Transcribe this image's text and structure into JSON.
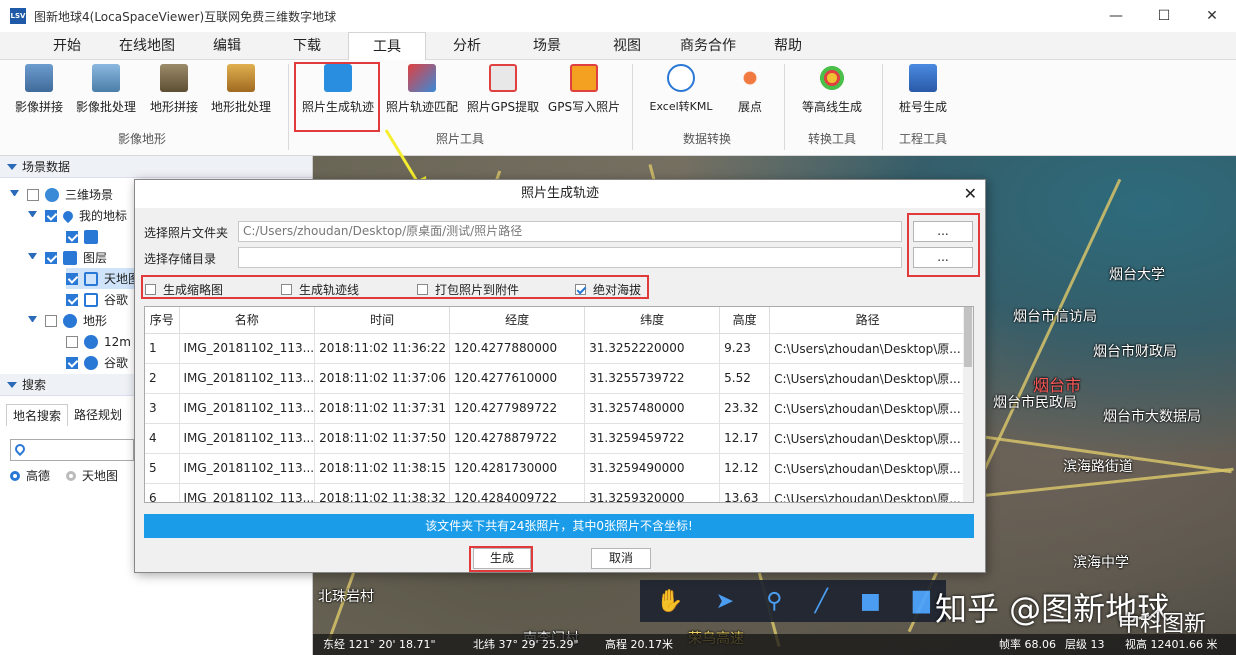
{
  "window": {
    "logo": "LSV",
    "title": "图新地球4(LocaSpaceViewer)互联网免费三维数字地球",
    "minimize": "—",
    "maximize": "☐",
    "close": "✕"
  },
  "menu": {
    "tabs": [
      "开始",
      "在线地图",
      "编辑",
      "下载",
      "工具",
      "分析",
      "场景",
      "视图",
      "商务合作",
      "帮助"
    ],
    "active": "工具"
  },
  "ribbon": {
    "buttons": [
      {
        "label": "影像拼接",
        "icon": "image-mosaic-icon"
      },
      {
        "label": "影像批处理",
        "icon": "image-batch-icon"
      },
      {
        "label": "地形拼接",
        "icon": "terrain-mosaic-icon"
      },
      {
        "label": "地形批处理",
        "icon": "terrain-batch-icon"
      },
      {
        "label": "照片生成轨迹",
        "icon": "camera-icon"
      },
      {
        "label": "照片轨迹匹配",
        "icon": "track-match-icon"
      },
      {
        "label": "照片GPS提取",
        "icon": "gps-extract-icon"
      },
      {
        "label": "GPS写入照片",
        "icon": "gps-write-icon"
      },
      {
        "label": "Excel转KML",
        "icon": "convert-icon"
      },
      {
        "label": "展点",
        "icon": "points-icon"
      },
      {
        "label": "等高线生成",
        "icon": "contour-icon"
      },
      {
        "label": "桩号生成",
        "icon": "station-icon"
      }
    ],
    "groups": [
      "影像地形",
      "照片工具",
      "数据转换",
      "转换工具",
      "工程工具"
    ]
  },
  "scene_panel": {
    "header": "场景数据",
    "items": [
      {
        "label": "三维场景"
      },
      {
        "label": "我的地标"
      },
      {
        "label": ""
      },
      {
        "label": "图层"
      },
      {
        "label": "天地图"
      },
      {
        "label": "谷歌"
      },
      {
        "label": "地形"
      },
      {
        "label": "12m"
      },
      {
        "label": "谷歌"
      }
    ]
  },
  "search_panel": {
    "header": "搜索",
    "tabs": [
      "地名搜索",
      "路径规划"
    ],
    "input_placeholder": "",
    "radios": [
      {
        "label": "高德",
        "selected": true
      },
      {
        "label": "天地图",
        "selected": false
      }
    ]
  },
  "map": {
    "labels": [
      {
        "text": "烟台大学"
      },
      {
        "text": "烟台市信访局"
      },
      {
        "text": "烟台市财政局"
      },
      {
        "text": "烟台市"
      },
      {
        "text": "烟台市民政局"
      },
      {
        "text": "烟台市大数据局"
      },
      {
        "text": "滨海路街道"
      },
      {
        "text": "滨海中学"
      },
      {
        "text": "北珠岩村"
      },
      {
        "text": "南李门村"
      },
      {
        "text": "荣乌高速"
      }
    ],
    "status": {
      "lon": "东经 121° 20' 18.71\"",
      "lat": "北纬 37° 29' 25.29\"",
      "alt": "高程 20.17米",
      "fps": "帧率 68.06",
      "level": "层级 13",
      "view_alt": "视高 12401.66 米"
    },
    "watermark": "知乎 @图新地球",
    "watermark2": "中科图新"
  },
  "dialog": {
    "title": "照片生成轨迹",
    "close": "✕",
    "photo_folder_label": "选择照片文件夹",
    "photo_folder_value": "C:/Users/zhoudan/Desktop/原桌面/测试/照片路径",
    "save_dir_label": "选择存储目录",
    "save_dir_value": "",
    "browse": "...",
    "options": [
      {
        "label": "生成缩略图",
        "checked": false
      },
      {
        "label": "生成轨迹线",
        "checked": false
      },
      {
        "label": "打包照片到附件",
        "checked": false
      },
      {
        "label": "绝对海拔",
        "checked": true
      }
    ],
    "columns": [
      "序号",
      "名称",
      "时间",
      "经度",
      "纬度",
      "高度",
      "路径"
    ],
    "rows": [
      [
        "1",
        "IMG_20181102_113...",
        "2018:11:02 11:36:22",
        "120.4277880000",
        "31.3252220000",
        "9.23",
        "C:\\Users\\zhoudan\\Desktop\\原..."
      ],
      [
        "2",
        "IMG_20181102_113...",
        "2018:11:02 11:37:06",
        "120.4277610000",
        "31.3255739722",
        "5.52",
        "C:\\Users\\zhoudan\\Desktop\\原..."
      ],
      [
        "3",
        "IMG_20181102_113...",
        "2018:11:02 11:37:31",
        "120.4277989722",
        "31.3257480000",
        "23.32",
        "C:\\Users\\zhoudan\\Desktop\\原..."
      ],
      [
        "4",
        "IMG_20181102_113...",
        "2018:11:02 11:37:50",
        "120.4278879722",
        "31.3259459722",
        "12.17",
        "C:\\Users\\zhoudan\\Desktop\\原..."
      ],
      [
        "5",
        "IMG_20181102_113...",
        "2018:11:02 11:38:15",
        "120.4281730000",
        "31.3259490000",
        "12.12",
        "C:\\Users\\zhoudan\\Desktop\\原..."
      ],
      [
        "6",
        "IMG_20181102_113...",
        "2018:11:02 11:38:32",
        "120.4284009722",
        "31.3259320000",
        "13.63",
        "C:\\Users\\zhoudan\\Desktop\\原..."
      ]
    ],
    "info": "该文件夹下共有24张照片，其中0张照片不含坐标!",
    "generate": "生成",
    "cancel": "取消"
  },
  "colors": {
    "highlight": "#e03a3a",
    "accent": "#1b9ce8",
    "checkbox": "#2a78d6"
  }
}
